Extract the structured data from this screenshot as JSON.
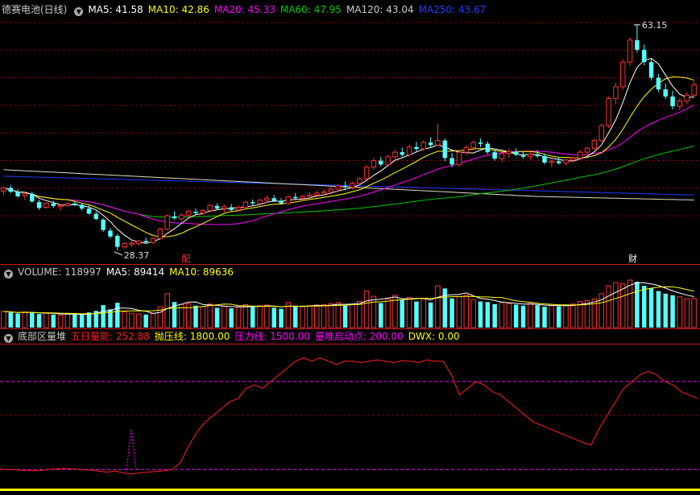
{
  "colors": {
    "up": "#ff3232",
    "down": "#54ffff",
    "grid": "#800000",
    "panel_sep": "#c81e1e",
    "ma5": "#ffffff",
    "ma10": "#ffff00",
    "ma20": "#ff00ff",
    "ma60": "#00c800",
    "ma120": "#e0e0c0",
    "ma250": "#1e3cff",
    "bottom_bar": "#ffff00",
    "osc": "#ff2020",
    "osc_level": "#ff00ff",
    "osc_spike": "#ff00ff"
  },
  "header_price": {
    "stock_name": "德赛电池(日线)",
    "ma5": "MA5: 41.58",
    "ma10": "MA10: 42.86",
    "ma20": "MA20: 45.33",
    "ma60": "MA60: 47.95",
    "ma120": "MA120: 43.04",
    "ma250": "MA250: 43.67"
  },
  "header_volume": {
    "volume": "VOLUME: 118997",
    "ma5": "MA5: 89414",
    "ma10": "MA10: 89636"
  },
  "header_indicator": {
    "name": "底部区量堆",
    "wurl": "五日量能: 252.88",
    "pyx": "抛压线: 1800.00",
    "ylx": "压力线: 1500.00",
    "ldqd": "量堆启动点: 200.00",
    "dwx": "DWX: 0.00"
  },
  "annotations": {
    "high_label": "63.15",
    "low_label": "28.37",
    "marker_1": "配",
    "marker_2": "财"
  },
  "chart_data": [
    {
      "type": "candlestick",
      "title": "德赛电池(日线)",
      "ylim": [
        26.5,
        64.5
      ],
      "high_marker": 63.15,
      "low_marker": 28.37,
      "candles_ohlc": [
        [
          37.5,
          38.2,
          36.9,
          38.0
        ],
        [
          38.0,
          38.4,
          37.2,
          37.4
        ],
        [
          37.4,
          37.8,
          36.5,
          36.7
        ],
        [
          36.8,
          37.3,
          36.1,
          37.1
        ],
        [
          37.1,
          37.4,
          35.7,
          35.9
        ],
        [
          35.8,
          36.2,
          34.6,
          34.9
        ],
        [
          35.0,
          35.8,
          34.8,
          35.6
        ],
        [
          35.6,
          36.0,
          34.9,
          35.2
        ],
        [
          35.1,
          35.5,
          34.5,
          35.3
        ],
        [
          35.3,
          35.8,
          35.0,
          35.6
        ],
        [
          35.6,
          35.9,
          35.2,
          35.4
        ],
        [
          35.4,
          35.6,
          34.5,
          34.8
        ],
        [
          34.8,
          35.3,
          33.9,
          34.0
        ],
        [
          34.0,
          34.4,
          33.0,
          33.2
        ],
        [
          33.1,
          33.3,
          31.2,
          31.5
        ],
        [
          31.4,
          31.8,
          30.2,
          30.5
        ],
        [
          30.6,
          30.9,
          28.37,
          28.9
        ],
        [
          28.9,
          29.6,
          28.6,
          29.4
        ],
        [
          29.3,
          29.8,
          28.9,
          29.5
        ],
        [
          29.4,
          30.0,
          29.0,
          29.8
        ],
        [
          29.8,
          30.3,
          29.3,
          29.6
        ],
        [
          29.6,
          30.4,
          29.3,
          30.2
        ],
        [
          30.2,
          31.9,
          30.0,
          31.6
        ],
        [
          31.6,
          33.9,
          31.4,
          33.7
        ],
        [
          33.6,
          34.4,
          33.1,
          33.3
        ],
        [
          33.2,
          34.1,
          32.9,
          33.8
        ],
        [
          33.8,
          34.6,
          33.4,
          34.4
        ],
        [
          34.3,
          34.8,
          33.9,
          34.1
        ],
        [
          34.1,
          34.7,
          33.8,
          34.5
        ],
        [
          34.5,
          35.5,
          34.2,
          35.3
        ],
        [
          35.2,
          35.6,
          34.6,
          34.8
        ],
        [
          34.8,
          35.4,
          34.2,
          35.1
        ],
        [
          35.0,
          35.5,
          34.4,
          34.6
        ],
        [
          34.6,
          35.3,
          34.3,
          35.0
        ],
        [
          35.0,
          36.0,
          34.8,
          35.8
        ],
        [
          35.8,
          36.2,
          35.3,
          35.6
        ],
        [
          35.6,
          36.3,
          35.2,
          36.1
        ],
        [
          36.1,
          36.8,
          35.7,
          36.4
        ],
        [
          36.4,
          36.9,
          35.8,
          36.0
        ],
        [
          36.0,
          36.4,
          35.4,
          35.6
        ],
        [
          35.6,
          36.8,
          35.4,
          36.6
        ],
        [
          36.6,
          37.2,
          36.1,
          36.4
        ],
        [
          36.4,
          36.9,
          35.9,
          36.7
        ],
        [
          36.7,
          37.4,
          36.2,
          36.9
        ],
        [
          36.9,
          37.5,
          36.4,
          37.2
        ],
        [
          37.2,
          37.8,
          36.7,
          37.4
        ],
        [
          37.4,
          38.1,
          36.9,
          37.8
        ],
        [
          37.8,
          38.6,
          37.4,
          38.3
        ],
        [
          38.3,
          39.0,
          37.7,
          38.1
        ],
        [
          38.1,
          38.9,
          37.8,
          38.7
        ],
        [
          38.7,
          39.6,
          38.4,
          39.4
        ],
        [
          39.4,
          41.5,
          39.2,
          41.2
        ],
        [
          41.2,
          42.6,
          40.8,
          42.2
        ],
        [
          42.2,
          42.8,
          41.3,
          41.6
        ],
        [
          41.6,
          43.1,
          41.2,
          42.8
        ],
        [
          42.8,
          43.9,
          42.3,
          43.5
        ],
        [
          43.5,
          44.2,
          42.8,
          43.1
        ],
        [
          43.1,
          44.6,
          42.9,
          44.3
        ],
        [
          44.3,
          45.1,
          43.6,
          44.0
        ],
        [
          44.0,
          45.4,
          43.7,
          45.0
        ],
        [
          45.0,
          45.8,
          44.2,
          44.6
        ],
        [
          44.6,
          47.9,
          44.4,
          45.3
        ],
        [
          45.3,
          45.6,
          42.1,
          42.6
        ],
        [
          42.6,
          43.4,
          41.2,
          41.6
        ],
        [
          41.6,
          43.8,
          41.2,
          43.5
        ],
        [
          43.5,
          44.6,
          43.0,
          44.2
        ],
        [
          44.2,
          45.3,
          43.7,
          45.0
        ],
        [
          45.0,
          45.6,
          44.3,
          44.8
        ],
        [
          44.8,
          45.2,
          43.2,
          43.5
        ],
        [
          43.5,
          43.9,
          42.2,
          42.5
        ],
        [
          42.5,
          43.6,
          42.0,
          43.3
        ],
        [
          43.3,
          44.0,
          42.6,
          43.6
        ],
        [
          43.6,
          44.1,
          42.9,
          43.1
        ],
        [
          43.1,
          43.7,
          42.5,
          42.8
        ],
        [
          42.8,
          43.5,
          42.3,
          43.2
        ],
        [
          43.2,
          43.8,
          42.6,
          42.9
        ],
        [
          42.9,
          43.3,
          41.6,
          41.9
        ],
        [
          41.9,
          42.4,
          41.2,
          42.1
        ],
        [
          42.1,
          42.7,
          41.6,
          41.8
        ],
        [
          41.8,
          42.5,
          41.5,
          42.3
        ],
        [
          42.3,
          42.9,
          41.9,
          42.6
        ],
        [
          42.6,
          43.8,
          42.3,
          43.5
        ],
        [
          43.5,
          44.4,
          43.1,
          44.1
        ],
        [
          44.1,
          45.6,
          43.8,
          45.3
        ],
        [
          45.3,
          47.9,
          45.0,
          47.6
        ],
        [
          47.6,
          52.1,
          47.2,
          51.8
        ],
        [
          51.8,
          54.2,
          50.9,
          53.6
        ],
        [
          53.6,
          57.9,
          53.1,
          57.4
        ],
        [
          57.4,
          61.2,
          56.8,
          60.8
        ],
        [
          60.8,
          63.15,
          58.9,
          59.3
        ],
        [
          59.3,
          60.1,
          56.9,
          57.4
        ],
        [
          57.4,
          57.9,
          54.6,
          55.0
        ],
        [
          55.0,
          55.6,
          52.8,
          53.2
        ],
        [
          53.2,
          54.1,
          51.7,
          52.1
        ],
        [
          52.1,
          53.0,
          50.1,
          50.6
        ],
        [
          50.6,
          51.8,
          50.0,
          51.4
        ],
        [
          51.4,
          52.8,
          50.9,
          52.3
        ],
        [
          52.3,
          54.4,
          51.8,
          53.9
        ]
      ]
    },
    {
      "type": "bar",
      "title": "VOLUME",
      "values": [
        62,
        58,
        54,
        60,
        57,
        52,
        55,
        50,
        48,
        53,
        51,
        49,
        58,
        64,
        86,
        70,
        95,
        60,
        55,
        52,
        50,
        54,
        80,
        130,
        98,
        88,
        92,
        84,
        80,
        90,
        76,
        82,
        74,
        78,
        88,
        80,
        84,
        86,
        76,
        72,
        96,
        82,
        80,
        84,
        86,
        88,
        92,
        96,
        84,
        90,
        100,
        140,
        120,
        94,
        110,
        124,
        108,
        116,
        100,
        110,
        96,
        160,
        150,
        112,
        118,
        124,
        106,
        100,
        98,
        90,
        96,
        92,
        88,
        84,
        92,
        86,
        80,
        84,
        82,
        86,
        90,
        100,
        104,
        110,
        130,
        160,
        172,
        168,
        182,
        176,
        160,
        150,
        140,
        130,
        124,
        118,
        110,
        112
      ]
    },
    {
      "type": "line",
      "title": "底部区量堆",
      "levels": {
        "抛压线": 1800,
        "压力线": 1500,
        "量堆启动点": 200,
        "DWX": 0
      },
      "series": [
        {
          "name": "五日量能",
          "values": [
            205,
            200,
            195,
            185,
            180,
            185,
            200,
            210,
            215,
            205,
            195,
            190,
            175,
            160,
            175,
            150,
            130,
            150,
            160,
            170,
            180,
            200,
            300,
            550,
            750,
            900,
            1000,
            1100,
            1200,
            1250,
            1400,
            1450,
            1400,
            1500,
            1600,
            1700,
            1800,
            1850,
            1800,
            1850,
            1800,
            1750,
            1800,
            1800,
            1780,
            1800,
            1820,
            1800,
            1780,
            1810,
            1800,
            1780,
            1820,
            1800,
            1800,
            1600,
            1300,
            1400,
            1500,
            1450,
            1350,
            1300,
            1200,
            1100,
            1000,
            900,
            850,
            800,
            750,
            700,
            650,
            600,
            560,
            800,
            1000,
            1200,
            1400,
            1500,
            1600,
            1650,
            1600,
            1500,
            1450,
            1350,
            1300,
            1250
          ]
        }
      ]
    }
  ]
}
